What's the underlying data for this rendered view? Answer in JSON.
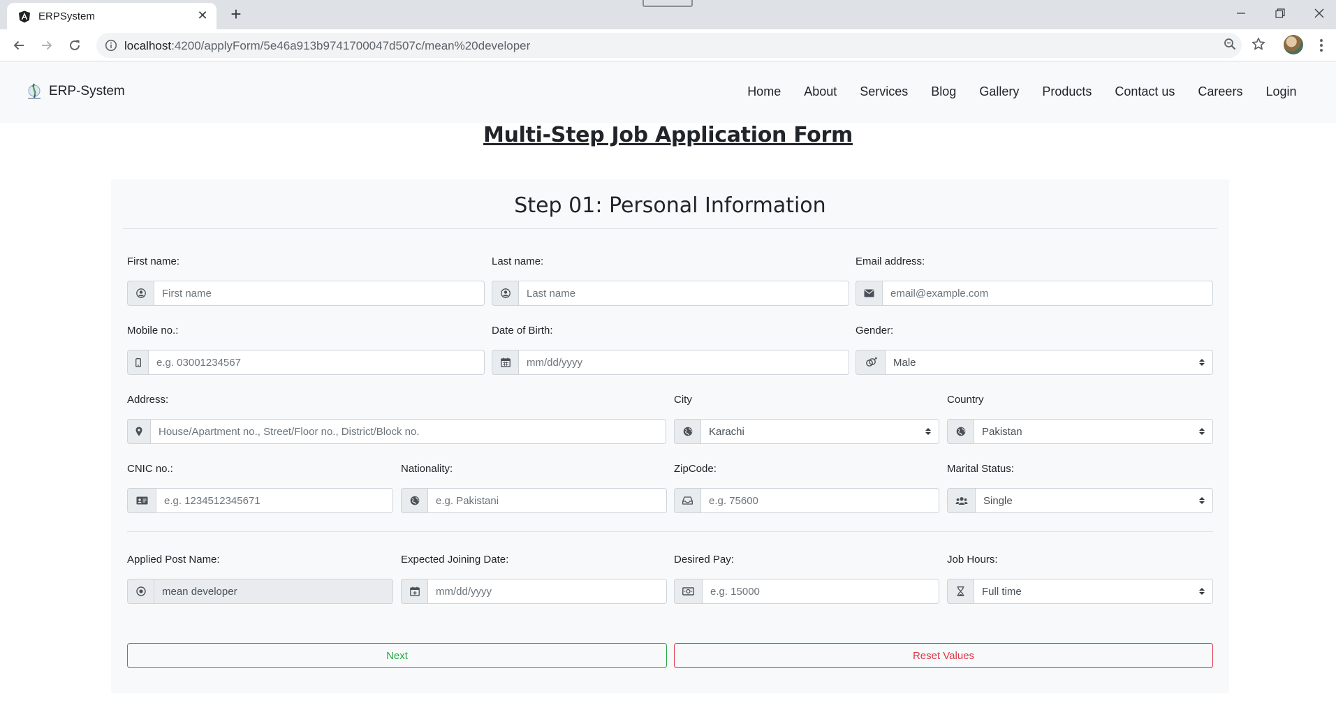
{
  "browser": {
    "tab_title": "ERPSystem",
    "url_host": "localhost",
    "url_path": ":4200/applyForm/5e46a913b9741700047d507c/mean%20developer"
  },
  "navbar": {
    "brand": "ERP-System",
    "links": [
      "Home",
      "About",
      "Services",
      "Blog",
      "Gallery",
      "Products",
      "Contact us",
      "Careers",
      "Login"
    ]
  },
  "page": {
    "title": "Multi-Step Job Application Form",
    "step_title": "Step 01: Personal Information"
  },
  "form": {
    "first_name": {
      "label": "First name:",
      "placeholder": "First name",
      "icon": "user-circle-icon"
    },
    "last_name": {
      "label": "Last name:",
      "placeholder": "Last name",
      "icon": "user-circle-icon"
    },
    "email": {
      "label": "Email address:",
      "placeholder": "email@example.com",
      "icon": "envelope-icon"
    },
    "mobile": {
      "label": "Mobile no.:",
      "placeholder": "e.g. 03001234567",
      "icon": "mobile-icon"
    },
    "dob": {
      "label": "Date of Birth:",
      "placeholder": "mm/dd/yyyy",
      "icon": "calendar-icon"
    },
    "gender": {
      "label": "Gender:",
      "value": "Male",
      "icon": "genderless-icon"
    },
    "address": {
      "label": "Address:",
      "placeholder": "House/Apartment no., Street/Floor no., District/Block no.",
      "icon": "map-marker-icon"
    },
    "city": {
      "label": "City",
      "value": "Karachi",
      "icon": "globe-icon"
    },
    "country": {
      "label": "Country",
      "value": "Pakistan",
      "icon": "globe-icon"
    },
    "cnic": {
      "label": "CNIC no.:",
      "placeholder": "e.g. 1234512345671",
      "icon": "id-card-icon"
    },
    "nationality": {
      "label": "Nationality:",
      "placeholder": "e.g. Pakistani",
      "icon": "globe-icon"
    },
    "zipcode": {
      "label": "ZipCode:",
      "placeholder": "e.g. 75600",
      "icon": "inbox-icon"
    },
    "marital_status": {
      "label": "Marital Status:",
      "value": "Single",
      "icon": "users-icon"
    },
    "applied_post": {
      "label": "Applied Post Name:",
      "value": "mean developer",
      "icon": "dot-circle-icon"
    },
    "joining_date": {
      "label": "Expected Joining Date:",
      "placeholder": "mm/dd/yyyy",
      "icon": "calendar-plus-icon"
    },
    "desired_pay": {
      "label": "Desired Pay:",
      "placeholder": "e.g. 15000",
      "icon": "money-bill-icon"
    },
    "job_hours": {
      "label": "Job Hours:",
      "value": "Full time",
      "icon": "hourglass-icon"
    }
  },
  "buttons": {
    "next": "Next",
    "reset": "Reset Values"
  },
  "colors": {
    "next_border": "#28a745",
    "reset_border": "#dc3545",
    "card_bg": "#f8f9fa"
  }
}
